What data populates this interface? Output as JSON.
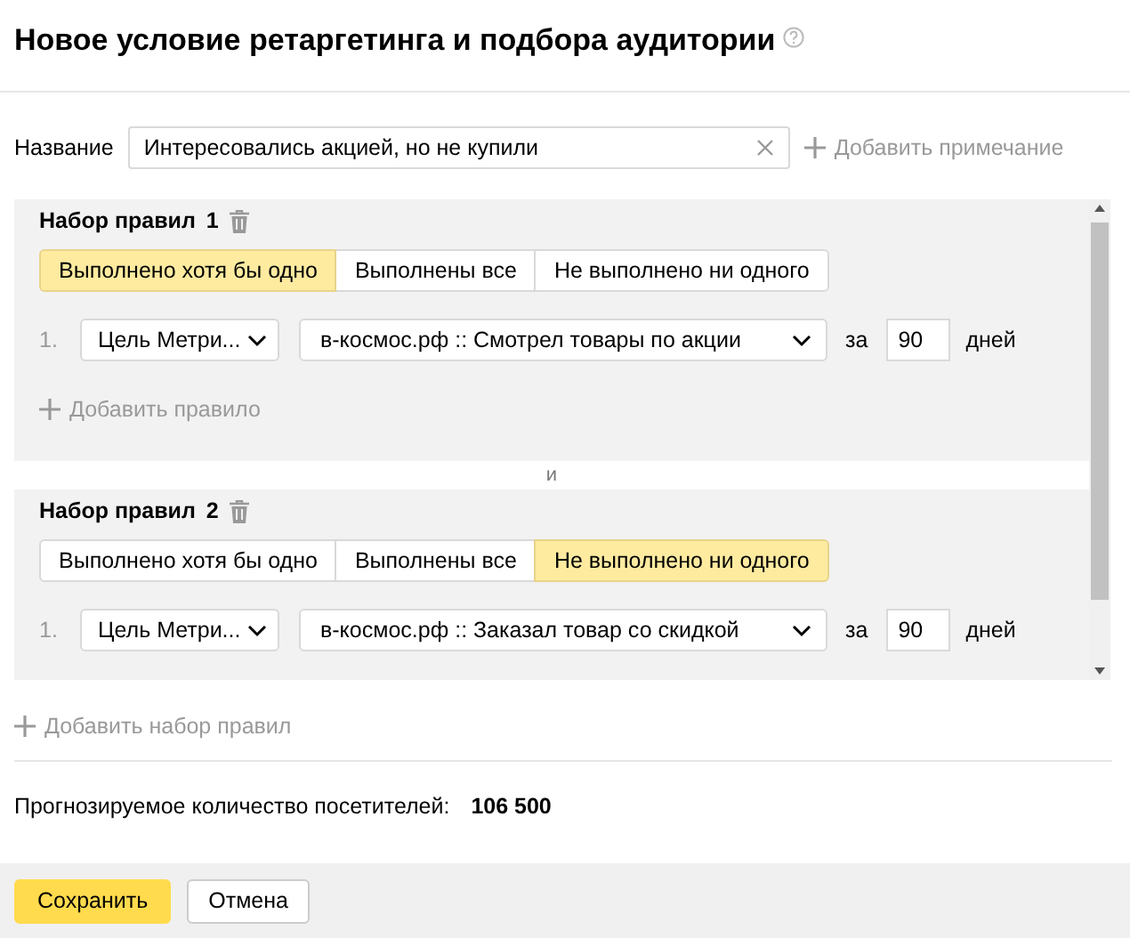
{
  "dialog": {
    "title": "Новое условие ретаргетинга и подбора аудитории"
  },
  "name_field": {
    "label": "Название",
    "value": "Интересовались акцией, но не купили",
    "add_note": "Добавить примечание"
  },
  "rule_sets": [
    {
      "title": "Набор правил",
      "number": "1",
      "modes": [
        {
          "label": "Выполнено хотя бы одно",
          "selected": true
        },
        {
          "label": "Выполнены все",
          "selected": false
        },
        {
          "label": "Не выполнено ни одного",
          "selected": false
        }
      ],
      "rules": [
        {
          "index": "1.",
          "type": "Цель Метри...",
          "goal": "в-космос.рф :: Смотрел товары по акции",
          "period_prefix": "за",
          "days": "90",
          "unit": "дней"
        }
      ],
      "add_rule": "Добавить правило"
    },
    {
      "title": "Набор правил",
      "number": "2",
      "modes": [
        {
          "label": "Выполнено хотя бы одно",
          "selected": false
        },
        {
          "label": "Выполнены все",
          "selected": false
        },
        {
          "label": "Не выполнено ни одного",
          "selected": true
        }
      ],
      "rules": [
        {
          "index": "1.",
          "type": "Цель Метри...",
          "goal": "в-космос.рф :: Заказал товар со скидкой",
          "period_prefix": "за",
          "days": "90",
          "unit": "дней"
        }
      ]
    }
  ],
  "separator": "и",
  "add_rule_set": "Добавить набор правил",
  "forecast": {
    "label": "Прогнозируемое количество посетителей:",
    "value": "106 500"
  },
  "buttons": [
    {
      "label": "Сохранить",
      "kind": "primary"
    },
    {
      "label": "Отмена",
      "kind": "secondary"
    }
  ]
}
